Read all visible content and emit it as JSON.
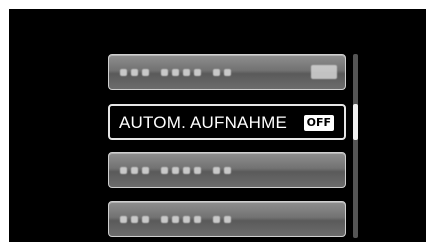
{
  "menu": {
    "items": [
      {
        "id": "item-0",
        "state": "blurred",
        "has_badge": true
      },
      {
        "id": "item-1",
        "state": "selected",
        "label": "AUTOM. AUFNAHME",
        "badge": "OFF"
      },
      {
        "id": "item-2",
        "state": "blurred",
        "has_badge": false
      },
      {
        "id": "item-3",
        "state": "blurred",
        "has_badge": false
      }
    ]
  },
  "colors": {
    "background": "#000000",
    "item_fill": "#727272",
    "item_border": "#cfcfcf",
    "selected_border": "#e6e6e6",
    "text": "#ffffff"
  },
  "scrollbar": {
    "visible_items": 4,
    "thumb_item_index": 1
  }
}
